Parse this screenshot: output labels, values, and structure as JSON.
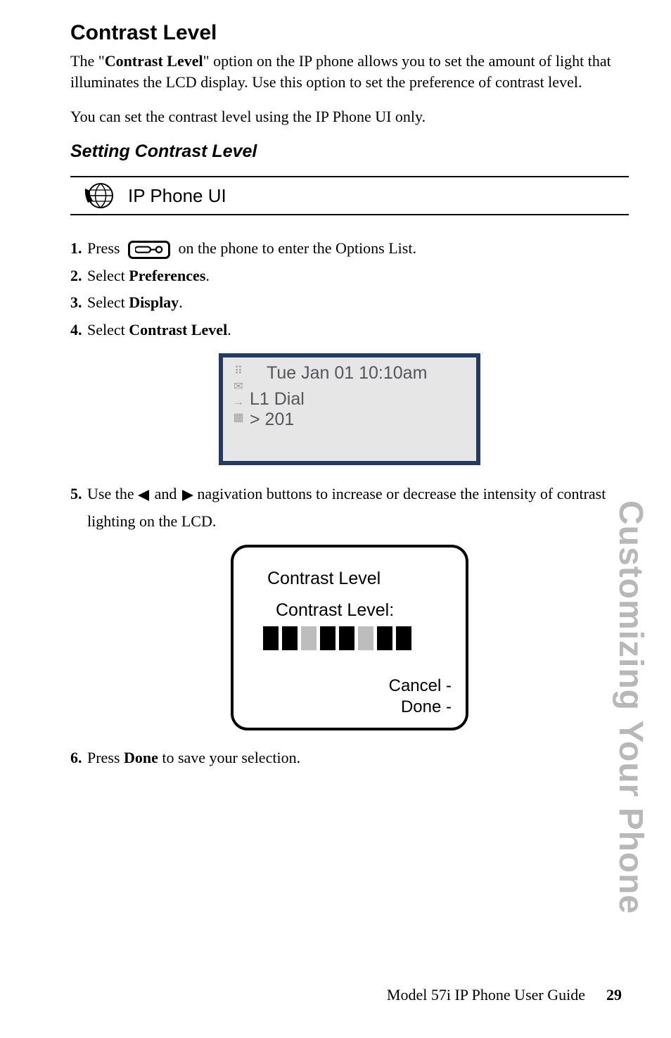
{
  "section": {
    "heading": "Contrast Level",
    "feature_name": "Contrast Level",
    "intro_pre": "The ",
    "intro_post": " option on the IP phone allows you to set the amount of light that illuminates the LCD display. Use this option to set the preference of contrast level.",
    "note": "You can set the contrast level using the IP Phone UI only.",
    "sub_heading": "Setting Contrast Level",
    "ui_bar_label": "IP Phone UI"
  },
  "steps1": [
    {
      "pre": "Press ",
      "post": " on the phone to enter the Options List."
    },
    {
      "pre": "Select ",
      "bold": "Preferences",
      "post": "."
    },
    {
      "pre": "Select ",
      "bold": "Display",
      "post": "."
    },
    {
      "pre": "Select ",
      "bold": "Contrast Level",
      "post": "."
    }
  ],
  "screen1": {
    "datetime": "Tue Jan 01  10:10am",
    "line": "L1 Dial",
    "number": "> 201"
  },
  "steps2": [
    {
      "pre": "Use the ",
      "mid": " and ",
      "post": " nagivation buttons to increase or decrease the intensity of contrast lighting on the LCD."
    }
  ],
  "screen2": {
    "title": "Contrast Level",
    "label": "Contrast Level:",
    "softkeys": [
      "Cancel -",
      "Done -"
    ]
  },
  "steps3": [
    {
      "pre": "Press ",
      "bold": "Done",
      "post": " to save your selection."
    }
  ],
  "footer": {
    "side": "Customizing Your Phone",
    "guide": "Model 57i IP Phone User Guide",
    "page": "29"
  }
}
